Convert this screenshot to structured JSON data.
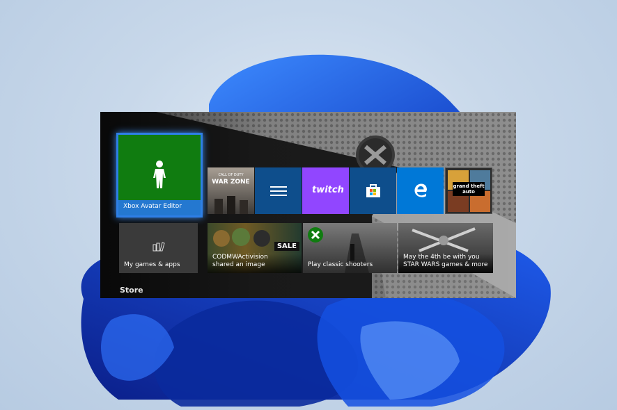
{
  "colors": {
    "accent_green": "#107c10",
    "focus_blue": "#2e7fe6",
    "twitch_purple": "#9146ff",
    "store_blue": "#0e4e8c",
    "edge_blue": "#0078d7"
  },
  "tiles": {
    "avatar_editor": {
      "label": "Xbox Avatar Editor",
      "icon": "avatar-figure-icon"
    },
    "my_games": {
      "label": "My games & apps",
      "icon": "games-apps-icon"
    },
    "codmw": {
      "label": "CODMWActivision\nshared an image",
      "badge": "SALE"
    },
    "classic_shooters": {
      "label": "Play classic shooters"
    },
    "star_wars": {
      "label": "May the 4th be with you\nSTAR WARS games & more"
    },
    "warzone": {
      "title_line1": "CALL OF DUTY",
      "title_line2": "WAR ZONE"
    },
    "twitch": {
      "text": "twitch"
    },
    "store": {
      "icon": "store-bag-icon"
    },
    "edge": {
      "icon": "edge-icon"
    },
    "gta": {
      "text": "grand theft auto"
    }
  },
  "section": {
    "store_label": "Store"
  }
}
